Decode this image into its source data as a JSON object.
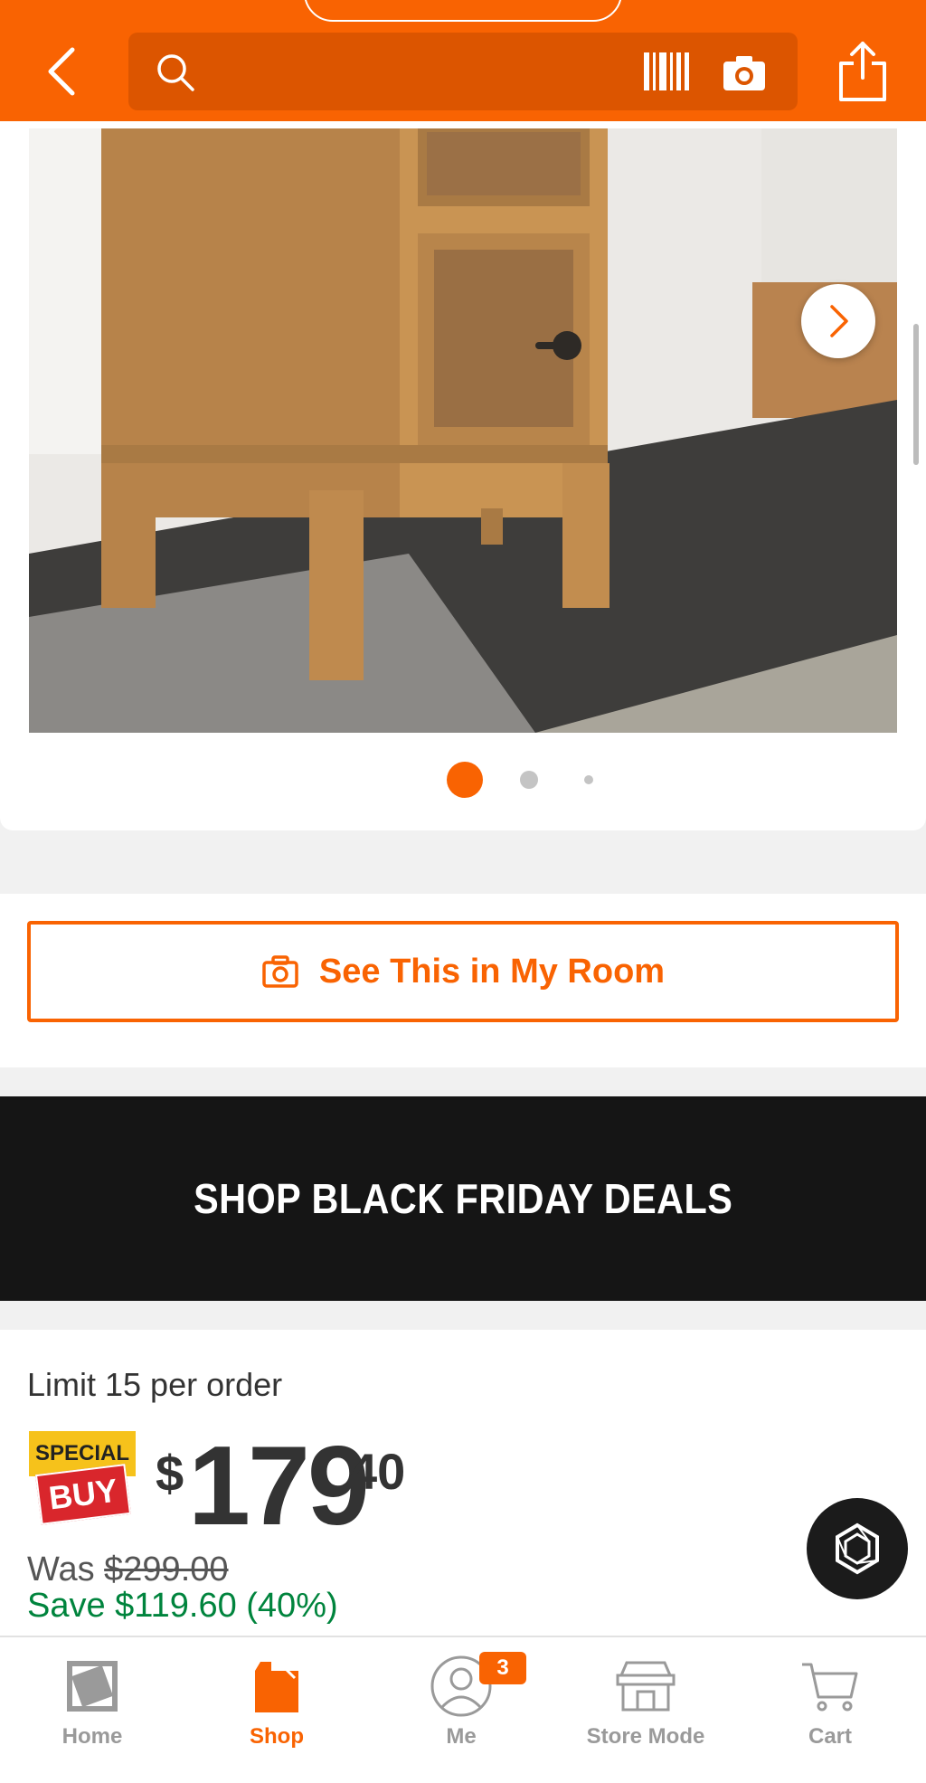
{
  "header": {
    "search_placeholder": "",
    "back_icon": "chevron-left-icon",
    "search_icon": "search-icon",
    "barcode_icon": "barcode-icon",
    "camera_icon": "camera-icon",
    "share_icon": "share-icon",
    "accent_color": "#f96302"
  },
  "gallery": {
    "image_description": "wooden nightstand with woven rattan drawers",
    "next_icon": "chevron-right-icon",
    "dot_count": 3,
    "active_dot": 1
  },
  "ar": {
    "label": "See This in My Room",
    "icon": "camera-icon"
  },
  "banner": {
    "label": "SHOP BLACK FRIDAY DEALS"
  },
  "pricing": {
    "limit": "Limit 15 per order",
    "badge_top": "SPECIAL",
    "badge_bottom": "BUY",
    "currency": "$",
    "dollars": "179",
    "cents": "40",
    "was_prefix": "Was ",
    "was_price": "$299.00",
    "save": "Save $119.60 (40%)"
  },
  "chat": {
    "icon": "chat-assistant-icon"
  },
  "nav": {
    "items": [
      {
        "label": "Home",
        "icon": "home-depot-logo-icon",
        "active": false
      },
      {
        "label": "Shop",
        "icon": "shop-icon",
        "active": true
      },
      {
        "label": "Me",
        "icon": "profile-icon",
        "active": false,
        "badge": "3"
      },
      {
        "label": "Store Mode",
        "icon": "store-icon",
        "active": false
      },
      {
        "label": "Cart",
        "icon": "cart-icon",
        "active": false
      }
    ]
  }
}
